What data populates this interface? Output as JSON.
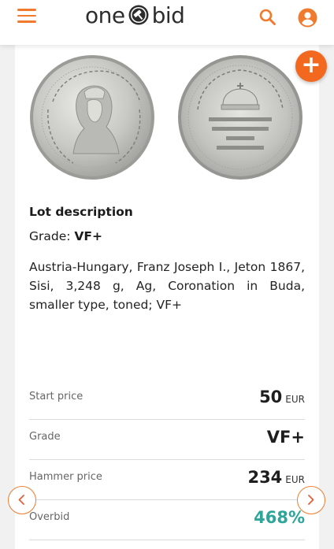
{
  "header": {
    "logo_left": "one",
    "logo_right": "bid",
    "menu_icon": "hamburger-menu-icon",
    "search_icon": "search-icon",
    "account_icon": "account-icon",
    "accent_color": "#f07b2f"
  },
  "lot": {
    "fab_label": "+",
    "description_title": "Lot description",
    "grade_label": "Grade: ",
    "grade_value": "VF+",
    "description_text": "Austria-Hungary, Franz Joseph I., Jeton 1867, Sisi, 3,248 g, Ag, Coronation in Buda, smaller type, toned; VF+"
  },
  "prices": {
    "start_price_label": "Start price",
    "start_price_value": "50",
    "start_price_currency": "EUR",
    "grade_label": "Grade",
    "grade_value": "VF+",
    "hammer_price_label": "Hammer price",
    "hammer_price_value": "234",
    "hammer_price_currency": "EUR",
    "overbid_label": "Overbid",
    "overbid_value": "468%",
    "overbid_color": "#2ea59a"
  },
  "navigation": {
    "prev_icon": "chevron-left-icon",
    "next_icon": "chevron-right-icon"
  }
}
